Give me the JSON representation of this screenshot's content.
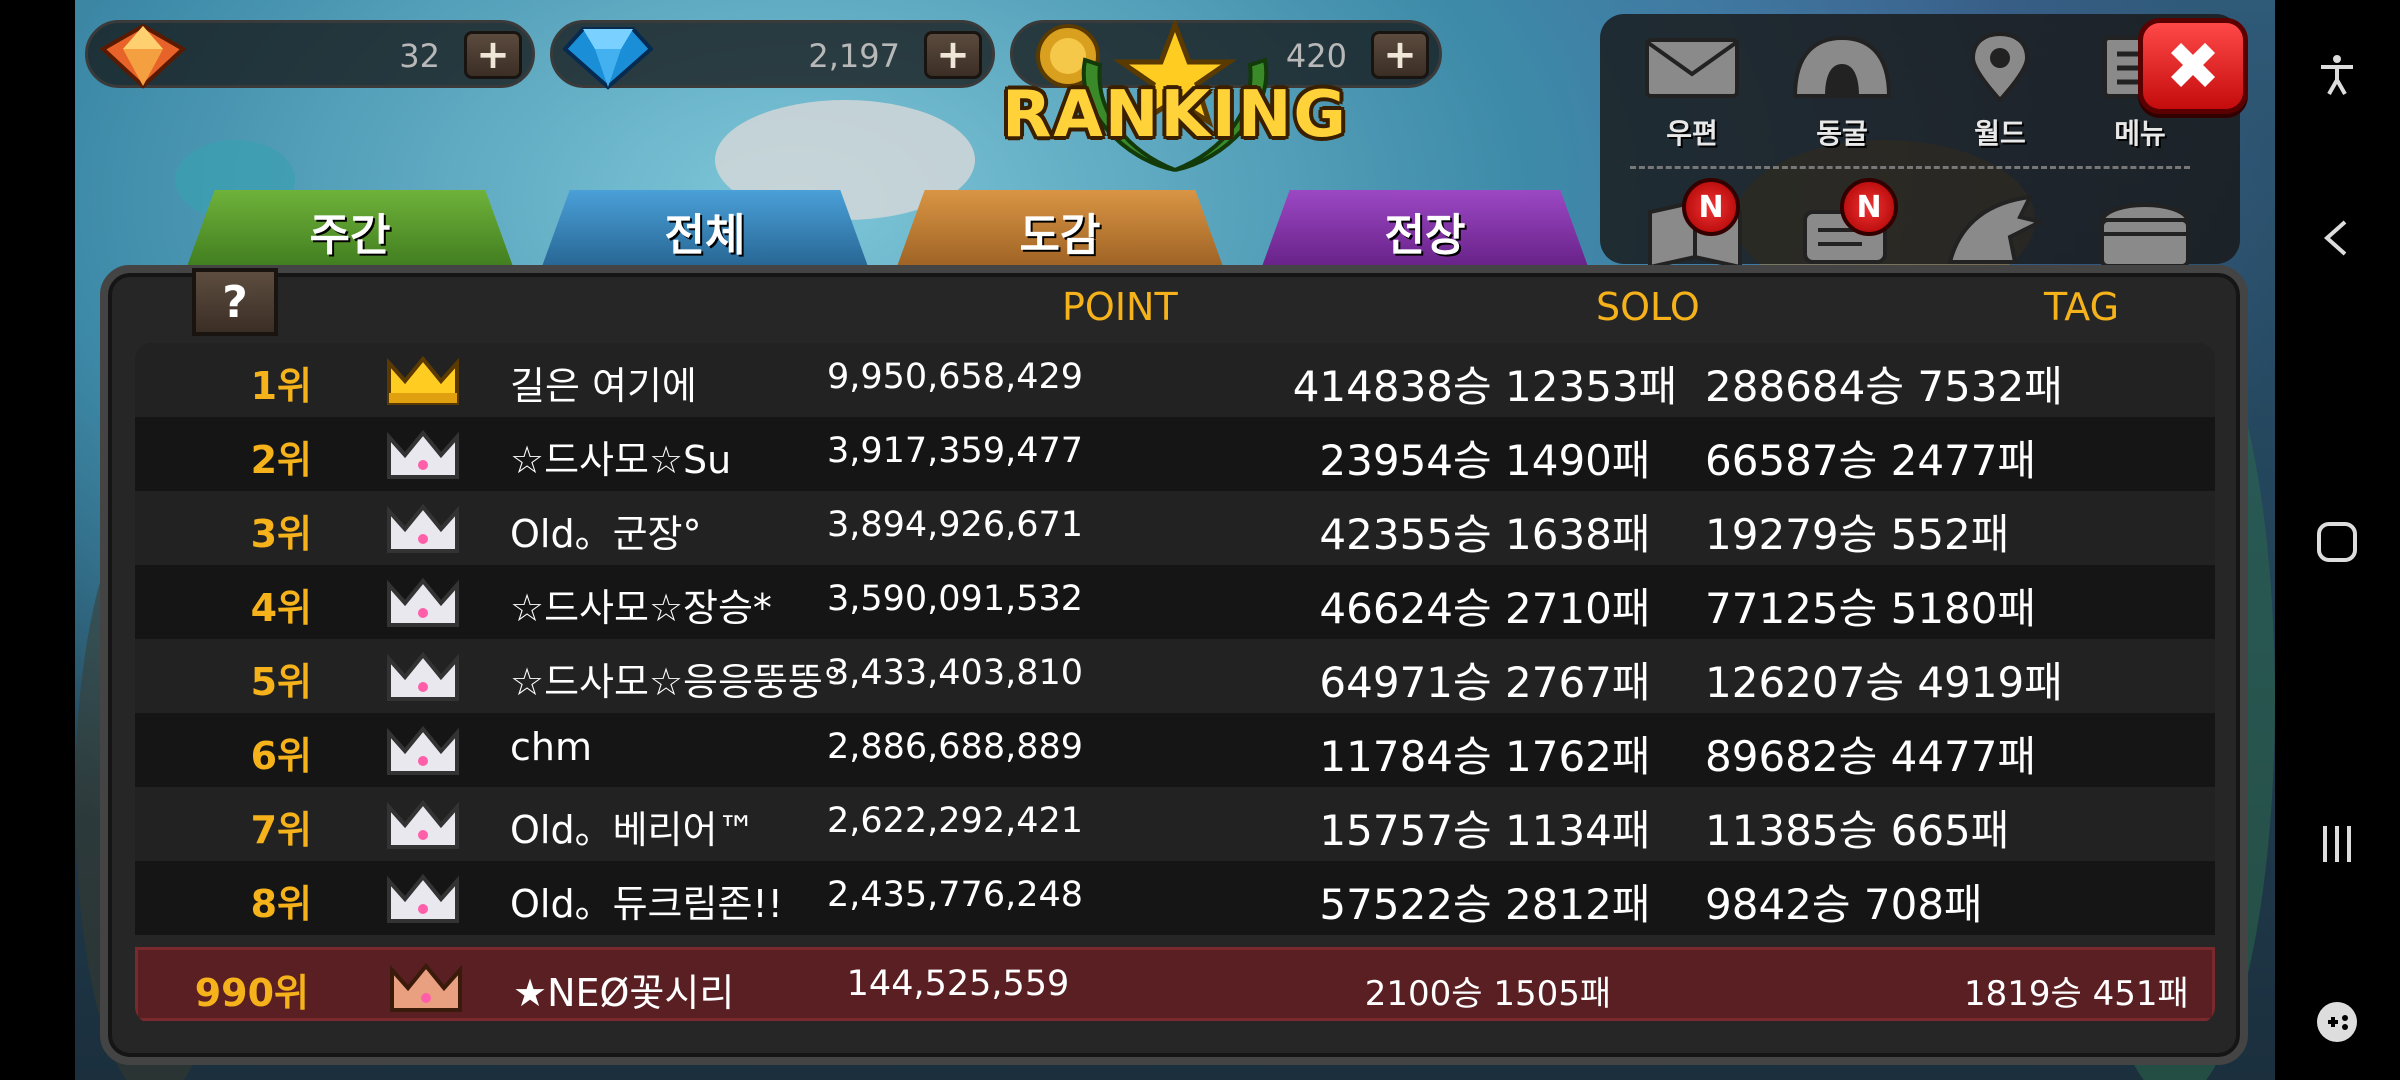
{
  "currencies": [
    {
      "name": "gem-orange",
      "value": "32"
    },
    {
      "name": "gem-blue",
      "value": "2,197"
    },
    {
      "name": "coin",
      "value": "420"
    }
  ],
  "logo": {
    "title": "RANKING"
  },
  "menu": {
    "items": [
      {
        "id": "mail",
        "label": "우편"
      },
      {
        "id": "cave",
        "label": "동굴"
      },
      {
        "id": "world",
        "label": "월드"
      },
      {
        "id": "menu",
        "label": "메뉴"
      }
    ],
    "badge": "N"
  },
  "tabs": [
    {
      "label": "주간",
      "color": "#4a8c2a"
    },
    {
      "label": "전체",
      "color": "#2f74a8"
    },
    {
      "label": "도감",
      "color": "#b8742c"
    },
    {
      "label": "전장",
      "color": "#7c2e9e"
    }
  ],
  "help_label": "?",
  "columns": {
    "point": "POINT",
    "solo": "SOLO",
    "tag": "TAG"
  },
  "rows": [
    {
      "rank": "1위",
      "crown": "gold",
      "name": "길은 여기에",
      "point": "9,950,658,429",
      "solo": "414838승 12353패",
      "tag": "288684승 7532패"
    },
    {
      "rank": "2위",
      "crown": "silver",
      "name": "☆드사모☆Su",
      "point": "3,917,359,477",
      "solo": "23954승 1490패",
      "tag": "66587승 2477패"
    },
    {
      "rank": "3위",
      "crown": "silver",
      "name": "Old。군장°",
      "point": "3,894,926,671",
      "solo": "42355승 1638패",
      "tag": "19279승 552패"
    },
    {
      "rank": "4위",
      "crown": "silver",
      "name": "☆드사모☆장승*",
      "point": "3,590,091,532",
      "solo": "46624승 2710패",
      "tag": "77125승 5180패"
    },
    {
      "rank": "5위",
      "crown": "silver",
      "name": "☆드사모☆응응뚱뚱°",
      "point": "3,433,403,810",
      "solo": "64971승 2767패",
      "tag": "126207승 4919패"
    },
    {
      "rank": "6위",
      "crown": "silver",
      "name": "chm",
      "point": "2,886,688,889",
      "solo": "11784승 1762패",
      "tag": "89682승 4477패"
    },
    {
      "rank": "7위",
      "crown": "silver",
      "name": "Old。베리어™",
      "point": "2,622,292,421",
      "solo": "15757승 1134패",
      "tag": "11385승 665패"
    },
    {
      "rank": "8위",
      "crown": "silver",
      "name": "Old。듀크림존!!",
      "point": "2,435,776,248",
      "solo": "57522승 2812패",
      "tag": "9842승 708패"
    }
  ],
  "my_row": {
    "rank": "990위",
    "crown": "bronze",
    "name": "★NEØ꽃시리",
    "point": "144,525,559",
    "solo": "2100승 1505패",
    "tag": "1819승 451패"
  },
  "colors": {
    "accent": "#f5b21a",
    "close": "#e02020",
    "my_row_bg": "#5a1f22"
  }
}
